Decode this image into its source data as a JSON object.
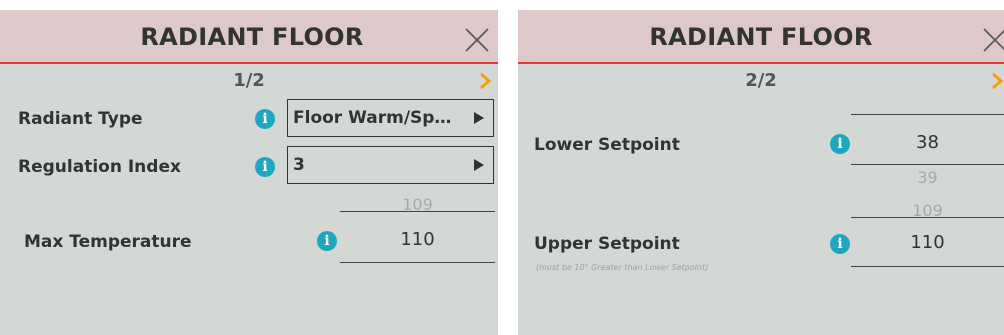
{
  "page1": {
    "title": "RADIANT FLOOR",
    "pager": "1/2",
    "radiant_type": {
      "label": "Radiant Type",
      "value": "Floor Warm/Sp…"
    },
    "regulation_index": {
      "label": "Regulation Index",
      "value": "3"
    },
    "max_temperature": {
      "label": "Max Temperature",
      "prev": "109",
      "value": "110"
    }
  },
  "page2": {
    "title": "RADIANT FLOOR",
    "pager": "2/2",
    "lower_setpoint": {
      "label": "Lower Setpoint",
      "value": "38",
      "next": "39"
    },
    "upper_setpoint": {
      "label": "Upper Setpoint",
      "note": "(must be 10° Greater than Lower Setpoint)",
      "prev": "109",
      "value": "110"
    }
  },
  "colors": {
    "header_bg": "#ddc9c9",
    "header_rule": "#e2373d",
    "panel_bg": "#d4d8d4",
    "info_icon": "#1ea7bf",
    "next_arrow": "#f39c12"
  },
  "icons": {
    "close": "close-icon",
    "next": "chevron-right-icon",
    "info": "info-icon",
    "dropdown": "triangle-right-icon"
  }
}
